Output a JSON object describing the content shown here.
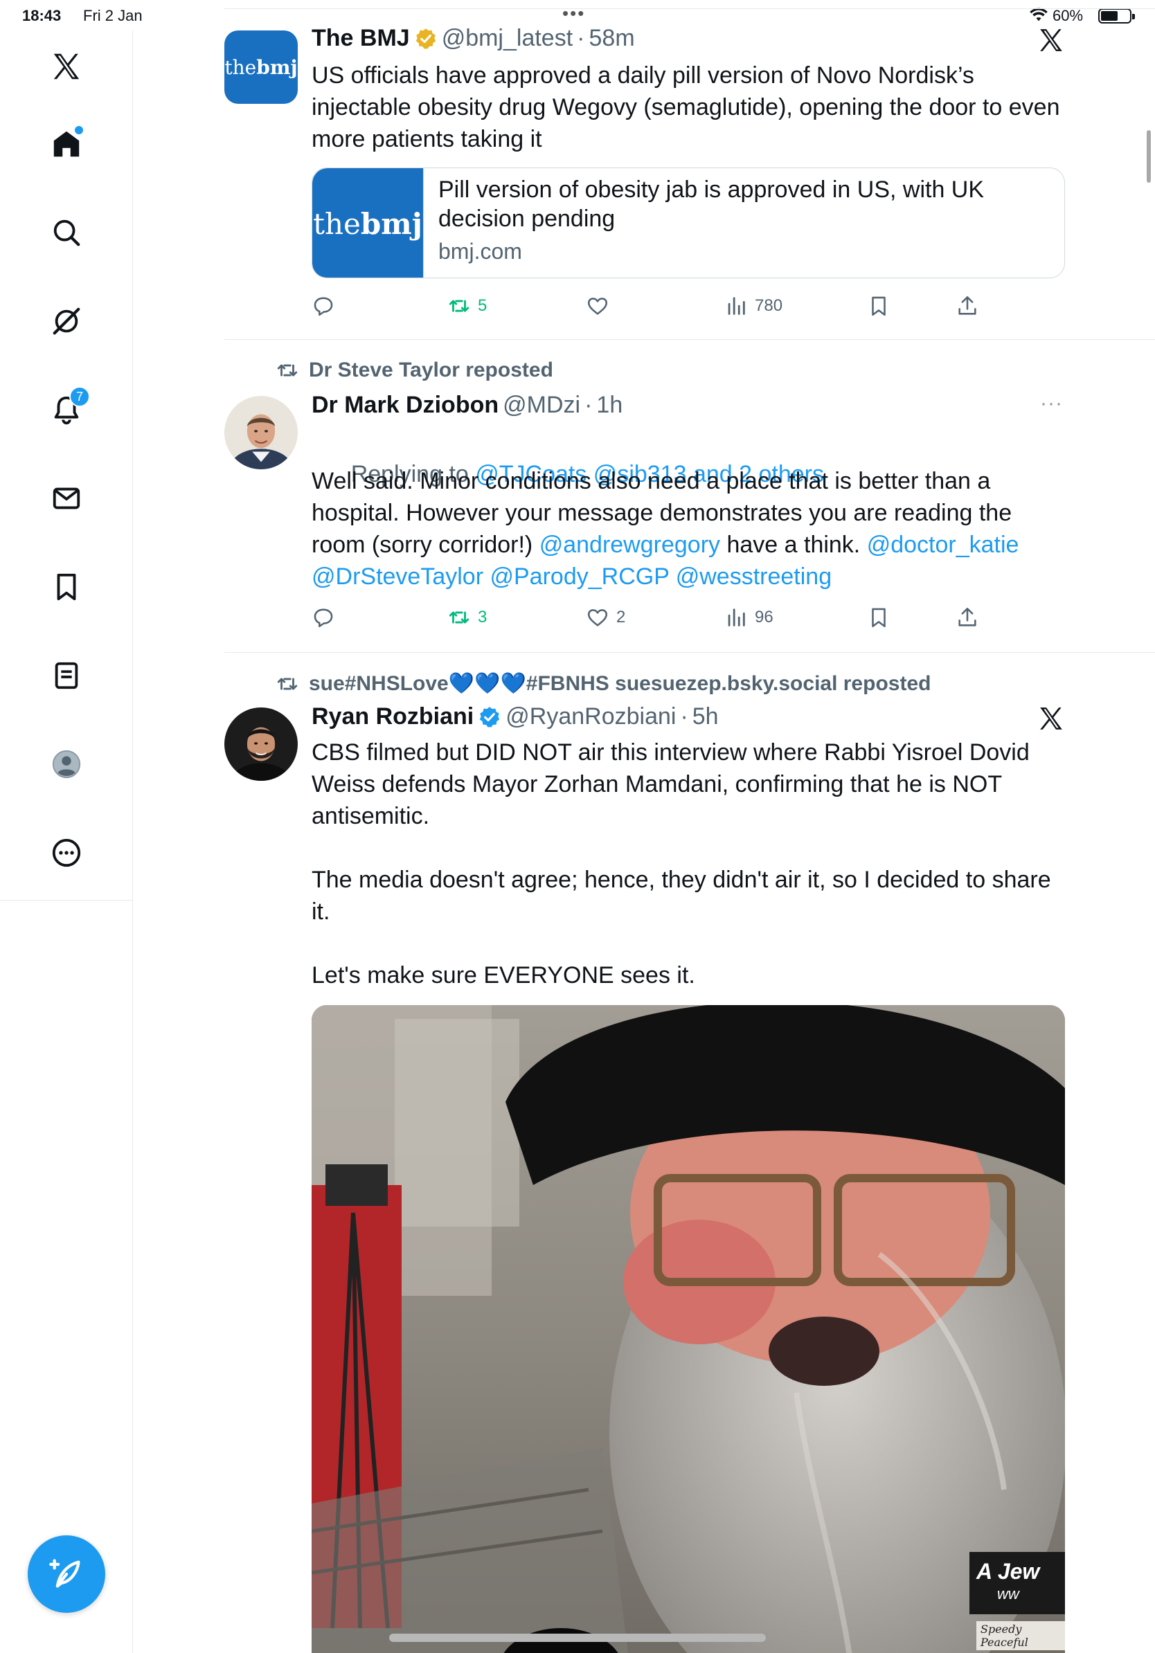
{
  "status_bar": {
    "time": "18:43",
    "date": "Fri 2 Jan",
    "battery": "60%",
    "battery_level": 0.6,
    "multitask_dots": "•••"
  },
  "sidebar": {
    "items": [
      {
        "name": "x-logo"
      },
      {
        "name": "home",
        "has_dot": true
      },
      {
        "name": "search"
      },
      {
        "name": "grok"
      },
      {
        "name": "notifications",
        "badge": "7"
      },
      {
        "name": "messages"
      },
      {
        "name": "bookmarks"
      },
      {
        "name": "lists"
      },
      {
        "name": "profile"
      },
      {
        "name": "more"
      }
    ],
    "compose_label": "+"
  },
  "colors": {
    "accent": "#1d9bf0",
    "text": "#0f1419",
    "muted": "#536471",
    "repost_green": "#00ba7c",
    "bmj_blue": "#1a70c0",
    "verified_gold": "#e8b425",
    "verified_blue": "#1d9bf0"
  },
  "tweets": [
    {
      "author": "The BMJ",
      "verified": "gold",
      "handle": "@bmj_latest",
      "time": "58m",
      "avatar_text_light": "the",
      "avatar_text_bold": "bmj",
      "text": "US officials have approved a daily pill version of Novo Nordisk’s injectable obesity drug Wegovy (semaglutide), opening the door to even more patients taking it",
      "card": {
        "title": "Pill version of obesity jab is approved in US, with UK decision pending",
        "domain": "bmj.com",
        "thumb_light": "the",
        "thumb_bold": "bmj"
      },
      "stats": {
        "replies": "",
        "reposts": "5",
        "likes": "",
        "views": "780"
      }
    },
    {
      "reposted_by": "Dr Steve Taylor reposted",
      "author": "Dr Mark Dziobon",
      "handle": "@MDzi",
      "time": "1h",
      "replying_label": "Replying to",
      "replying_to": "@TJCoats @sib313 and 2 others",
      "text_plain": "Well said. Minor conditions also need a place that is better than a hospital. However your message demonstrates you are reading the room (sorry corridor!) ",
      "mention1": "@andrewgregory",
      "text_mid": " have a think. ",
      "mention2": "@doctor_katie",
      "mention3": "@DrSteveTaylor",
      "mention4": "@Parody_RCGP",
      "mention5": "@wesstreeting",
      "more": "···",
      "stats": {
        "replies": "",
        "reposts": "3",
        "likes": "2",
        "views": "96"
      }
    },
    {
      "reposted_by": "sue#NHSLove💙💙💙#FBNHS suesuezep.bsky.social reposted",
      "author": "Ryan Rozbiani",
      "verified": "blue",
      "handle": "@RyanRozbiani",
      "time": "5h",
      "text": "CBS filmed but DID NOT air this interview where Rabbi Yisroel Dovid Weiss defends Mayor Zorhan Mamdani, confirming that he is NOT antisemitic.\n\nThe media doesn't agree; hence, they didn't air it, so I decided to share it.\n\nLet's make sure EVERYONE sees it.",
      "media_badge": "A Jew",
      "media_badge2": "ww",
      "media_caption": "Speedy Peaceful"
    }
  ]
}
